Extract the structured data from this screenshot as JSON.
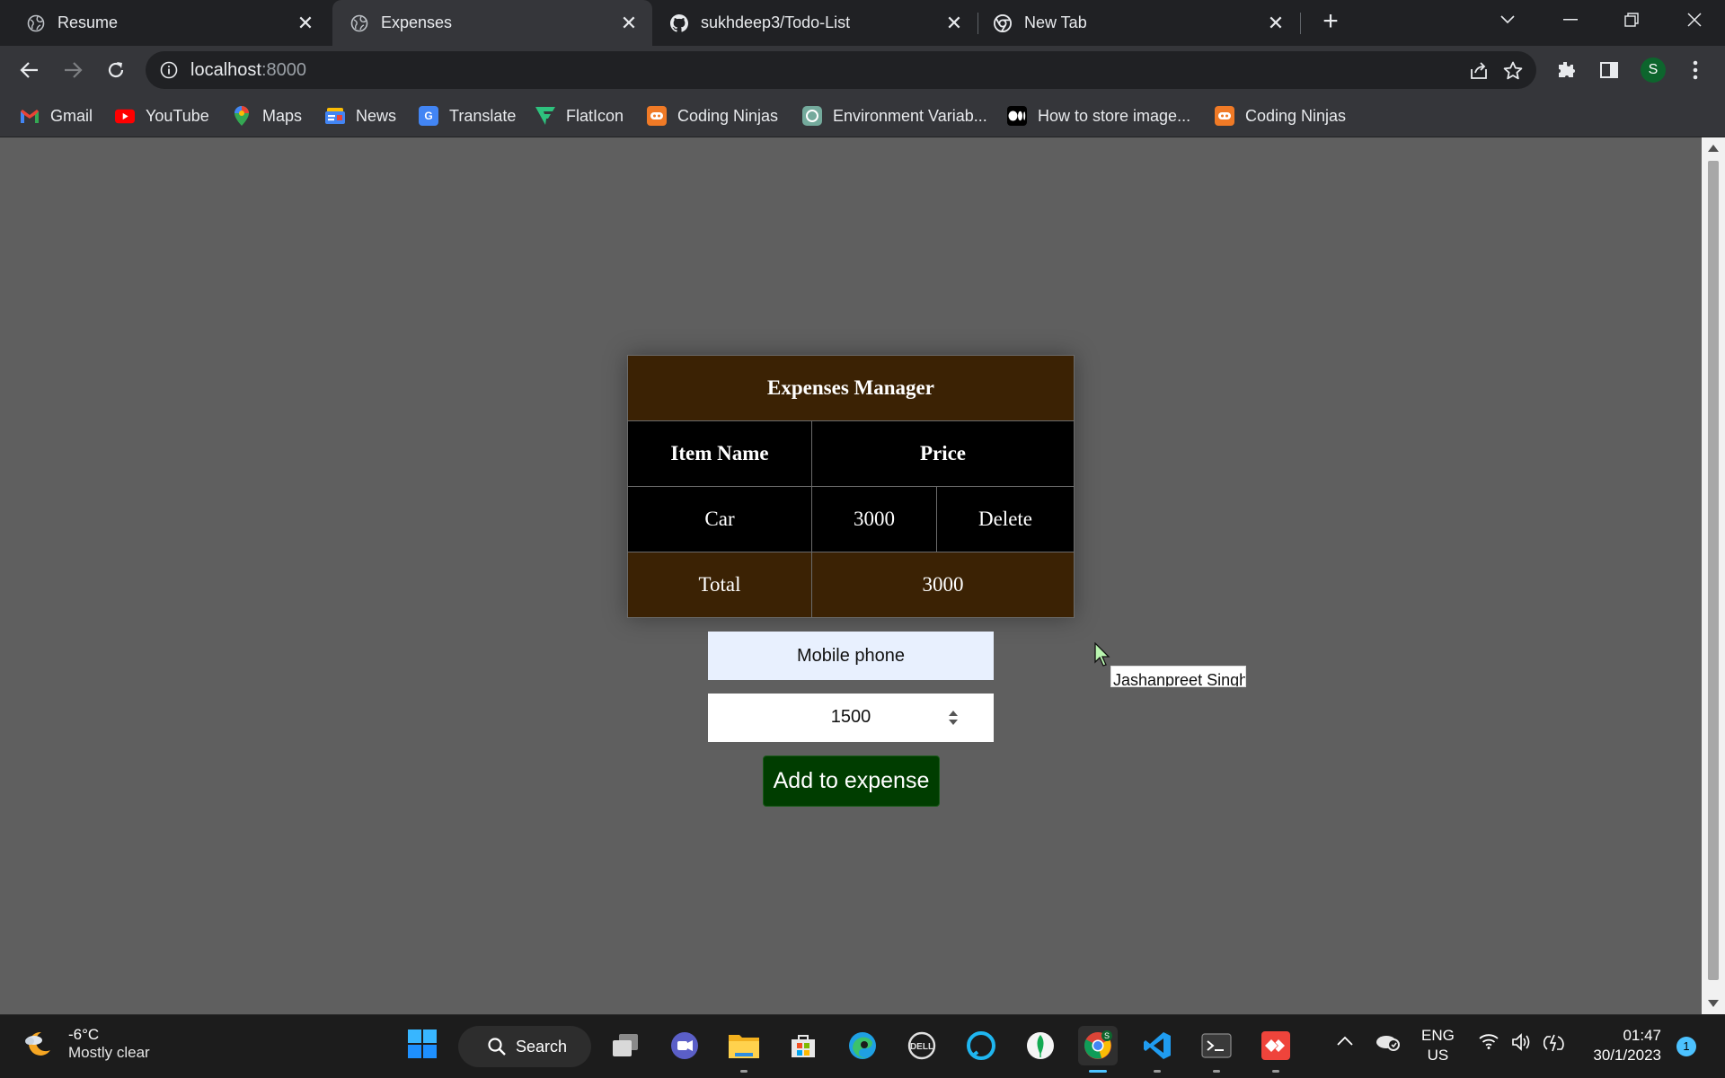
{
  "browser": {
    "tabs": [
      {
        "title": "Resume",
        "icon": "globe-icon",
        "active": false
      },
      {
        "title": "Expenses",
        "icon": "globe-icon",
        "active": true
      },
      {
        "title": "sukhdeep3/Todo-List",
        "icon": "github-icon",
        "active": false
      },
      {
        "title": "New Tab",
        "icon": "chrome-icon",
        "active": false
      }
    ],
    "new_tab_label": "+",
    "close_glyph": "✕",
    "url_host": "localhost",
    "url_port": ":8000",
    "profile_initial": "S",
    "bookmarks": [
      {
        "label": "Gmail",
        "icon": "gmail-icon"
      },
      {
        "label": "YouTube",
        "icon": "youtube-icon"
      },
      {
        "label": "Maps",
        "icon": "maps-icon"
      },
      {
        "label": "News",
        "icon": "news-icon"
      },
      {
        "label": "Translate",
        "icon": "translate-icon"
      },
      {
        "label": "FlatIcon",
        "icon": "flaticon-icon"
      },
      {
        "label": "Coding Ninjas",
        "icon": "coding-ninjas-icon"
      },
      {
        "label": "Environment Variab...",
        "icon": "environment-icon"
      },
      {
        "label": "How to store image...",
        "icon": "medium-icon"
      },
      {
        "label": "Coding Ninjas",
        "icon": "coding-ninjas-icon"
      }
    ]
  },
  "app": {
    "title": "Expenses Manager",
    "columns": {
      "item": "Item Name",
      "price": "Price"
    },
    "rows": [
      {
        "name": "Car",
        "price": "3000",
        "action": "Delete"
      }
    ],
    "total_label": "Total",
    "total_value": "3000",
    "name_input_value": "Mobile phone",
    "price_input_value": "1500",
    "add_button_label": "Add to expense",
    "tooltip_text": "Jashanpreet Singh",
    "colors": {
      "header_brown": "#3b2204",
      "button_green": "#003d00",
      "page_bg": "#5f5f5f"
    }
  },
  "taskbar": {
    "weather_temp": "-6°C",
    "weather_desc": "Mostly clear",
    "search_label": "Search",
    "lang_line1": "ENG",
    "lang_line2": "US",
    "time": "01:47",
    "date": "30/1/2023",
    "notification_count": "1",
    "chrome_badge": "S"
  }
}
